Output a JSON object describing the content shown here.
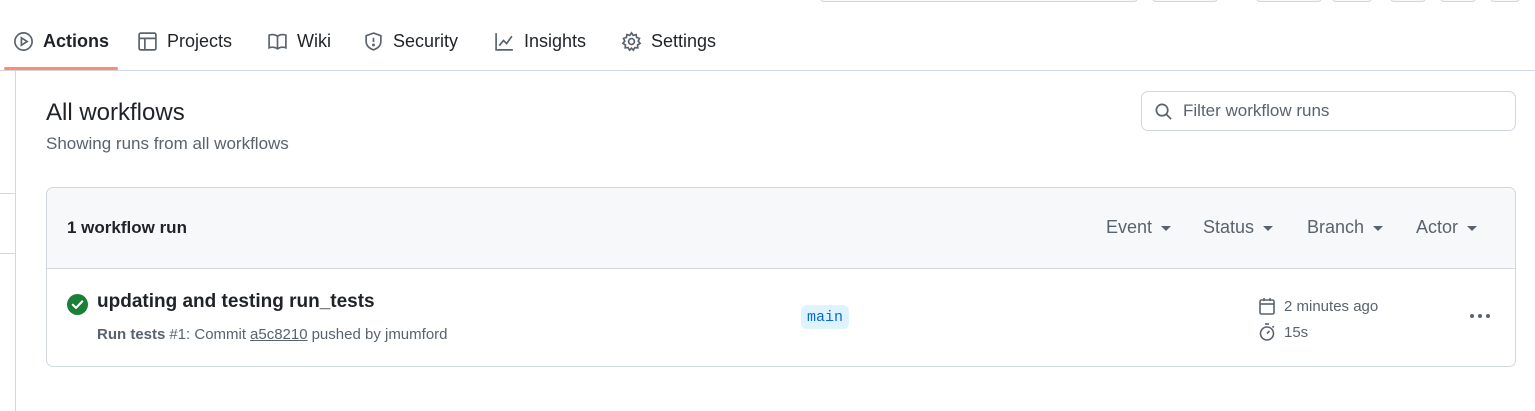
{
  "tabs": [
    {
      "label": "Actions",
      "icon": "play-icon",
      "active": true
    },
    {
      "label": "Projects",
      "icon": "table-icon",
      "active": false
    },
    {
      "label": "Wiki",
      "icon": "book-icon",
      "active": false
    },
    {
      "label": "Security",
      "icon": "shield-icon",
      "active": false
    },
    {
      "label": "Insights",
      "icon": "graph-icon",
      "active": false
    },
    {
      "label": "Settings",
      "icon": "gear-icon",
      "active": false
    }
  ],
  "header": {
    "title": "All workflows",
    "subtitle": "Showing runs from all workflows"
  },
  "filter": {
    "placeholder": "Filter workflow runs",
    "value": ""
  },
  "runs_box": {
    "count_label": "1 workflow run",
    "filters": [
      "Event",
      "Status",
      "Branch",
      "Actor"
    ]
  },
  "runs": [
    {
      "title": "updating and testing run_tests",
      "status": "success",
      "workflow": "Run tests",
      "run_number": "#1",
      "commit_prefix": ": Commit",
      "sha": "a5c8210",
      "pushed_by": "pushed by jmumford",
      "branch": "main",
      "time_ago": "2 minutes ago",
      "duration": "15s"
    }
  ],
  "colors": {
    "accent_underline": "#fd8c73",
    "success": "#1a7f37",
    "branch_bg": "#ddf4ff",
    "branch_text": "#0969da"
  }
}
